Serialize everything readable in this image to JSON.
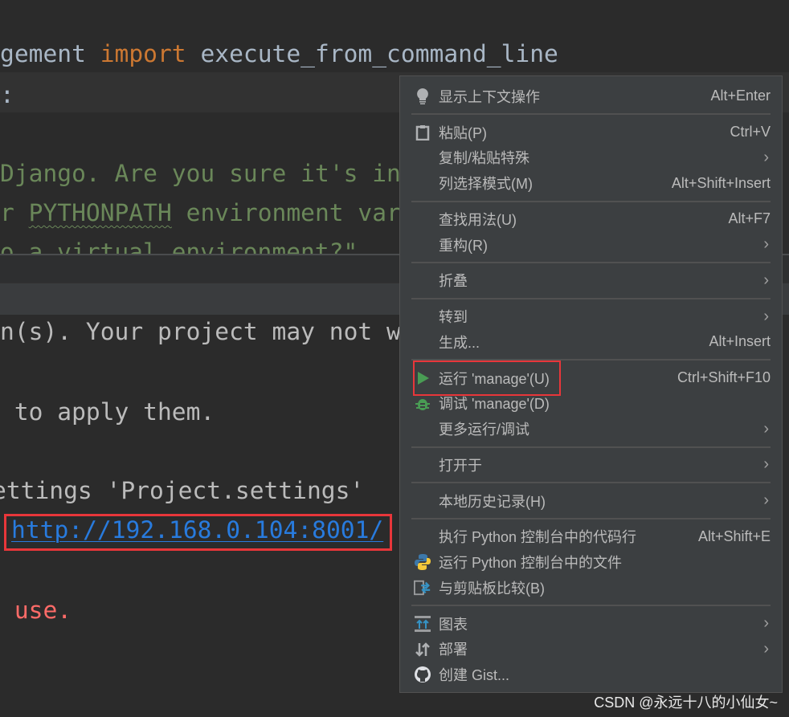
{
  "editor": {
    "line1": {
      "a": "gement ",
      "kw": "import",
      "b": " execute_from_command_line"
    },
    "line2": ":",
    "line3": "Django. Are you sure it's in",
    "line4": {
      "a": "r ",
      "env": "PYTHONPATH",
      "b": " environment var"
    },
    "line5": "to a virtual environment?\""
  },
  "console": {
    "line1": "n(s). Your project may not work",
    "line2": " to apply them.",
    "line3": "ettings 'Project.settings'",
    "link": "http://192.168.0.104:8001/",
    "line5": ".",
    "line6": " use."
  },
  "menu": {
    "groups": [
      [
        {
          "label": "显示上下文操作",
          "shortcut": "Alt+Enter",
          "icon": "lightbulb-icon"
        }
      ],
      [
        {
          "label": "粘贴(P)",
          "shortcut": "Ctrl+V",
          "icon": "clipboard-icon"
        },
        {
          "label": "复制/粘贴特殊",
          "submenu": true
        },
        {
          "label": "列选择模式(M)",
          "shortcut": "Alt+Shift+Insert"
        }
      ],
      [
        {
          "label": "查找用法(U)",
          "shortcut": "Alt+F7"
        },
        {
          "label": "重构(R)",
          "submenu": true
        }
      ],
      [
        {
          "label": "折叠",
          "submenu": true
        }
      ],
      [
        {
          "label": "转到",
          "submenu": true
        },
        {
          "label": "生成...",
          "shortcut": "Alt+Insert"
        }
      ],
      [
        {
          "label": "运行 'manage'(U)",
          "shortcut": "Ctrl+Shift+F10",
          "icon": "run-icon",
          "highlighted": true
        },
        {
          "label": "调试 'manage'(D)",
          "icon": "debug-bug-icon"
        },
        {
          "label": "更多运行/调试",
          "submenu": true
        }
      ],
      [
        {
          "label": "打开于",
          "submenu": true
        }
      ],
      [
        {
          "label": "本地历史记录(H)",
          "submenu": true
        }
      ],
      [
        {
          "label": "执行 Python 控制台中的代码行",
          "shortcut": "Alt+Shift+E"
        },
        {
          "label": "运行 Python 控制台中的文件",
          "icon": "python-icon"
        },
        {
          "label": "与剪贴板比较(B)",
          "icon": "compare-clipboard-icon"
        }
      ],
      [
        {
          "label": "图表",
          "submenu": true,
          "icon": "diagram-icon"
        },
        {
          "label": "部署",
          "submenu": true,
          "icon": "deploy-arrows-icon"
        },
        {
          "label": "创建 Gist...",
          "icon": "github-icon"
        }
      ]
    ],
    "submenu_glyph": "›"
  },
  "watermark": "CSDN @永远十八的小仙女~",
  "colors": {
    "highlight_box": "#e8363a",
    "link": "#287bde",
    "error": "#ff6b68",
    "menu_bg": "#3c3f41"
  }
}
